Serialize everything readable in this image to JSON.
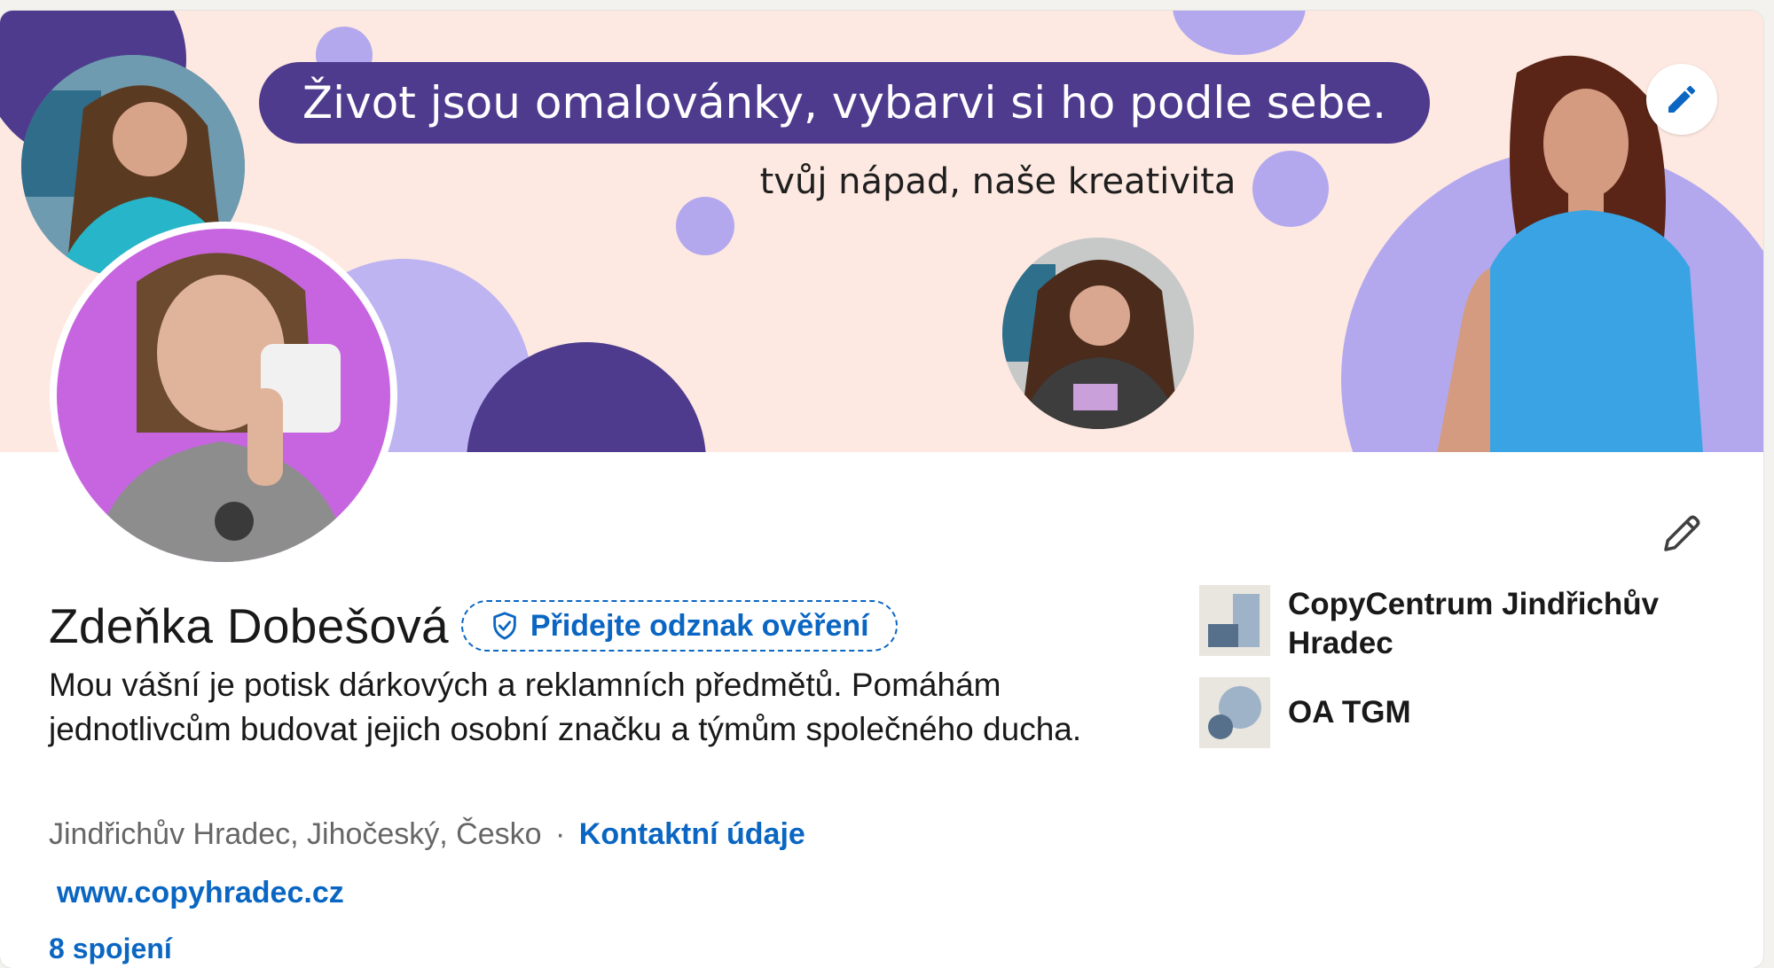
{
  "banner": {
    "quote": "Život jsou omalovánky, vybarvi si ho podle sebe.",
    "subtitle": "tvůj nápad, naše kreativita",
    "edit_icon": "pencil-icon"
  },
  "profile": {
    "name": "Zdeňka Dobešová",
    "verify_badge": {
      "label": "Přidejte odznak ověření",
      "icon": "shield-check-icon"
    },
    "headline": "Mou vášní je potisk dárkových a reklamních předmětů. Pomáhám jednotlivcům budovat jejich osobní značku a týmům společného ducha.",
    "location": "Jindřichův Hradec, Jihočeský, Česko",
    "separator": "·",
    "contact_link": "Kontaktní údaje",
    "website": "www.copyhradec.cz",
    "connections": "8 spojení",
    "edit_icon": "pencil-icon"
  },
  "organizations": [
    {
      "name": "CopyCentrum Jindřichův Hradec",
      "logo": "company-logo-icon"
    },
    {
      "name": "OA TGM",
      "logo": "school-logo-icon"
    }
  ],
  "colors": {
    "banner_bg": "#fde9e1",
    "dark_purple": "#4e3b8e",
    "lavender": "#b3a8ee",
    "link_blue": "#0a66c2",
    "avatar_bg": "#c765e0",
    "shirt_blue": "#3aa3e3"
  }
}
